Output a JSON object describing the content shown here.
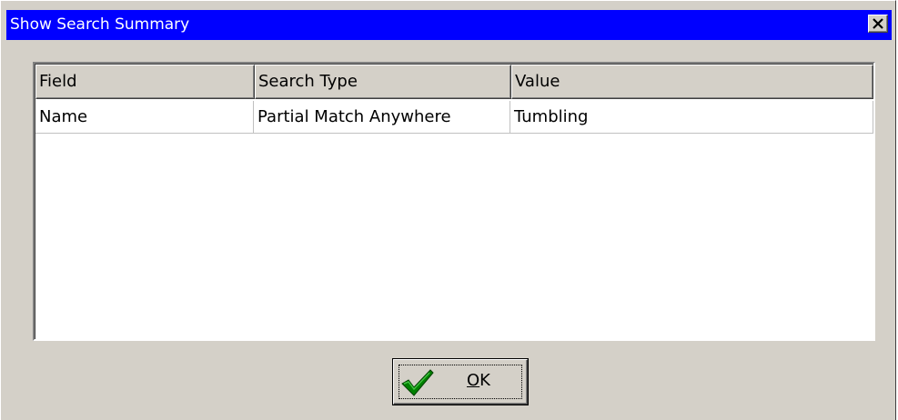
{
  "window": {
    "title": "Show Search Summary",
    "close_icon": "close-icon"
  },
  "grid": {
    "columns": [
      "Field",
      "Search Type",
      "Value"
    ],
    "rows": [
      {
        "field": "Name",
        "search_type": "Partial Match Anywhere",
        "value": "Tumbling"
      }
    ]
  },
  "ok_button": {
    "label_underlined": "O",
    "label_rest": "K",
    "icon": "checkmark-icon"
  },
  "colors": {
    "title_bar": "#0000ff",
    "face": "#d4d0c8",
    "check_green": "#008000"
  }
}
